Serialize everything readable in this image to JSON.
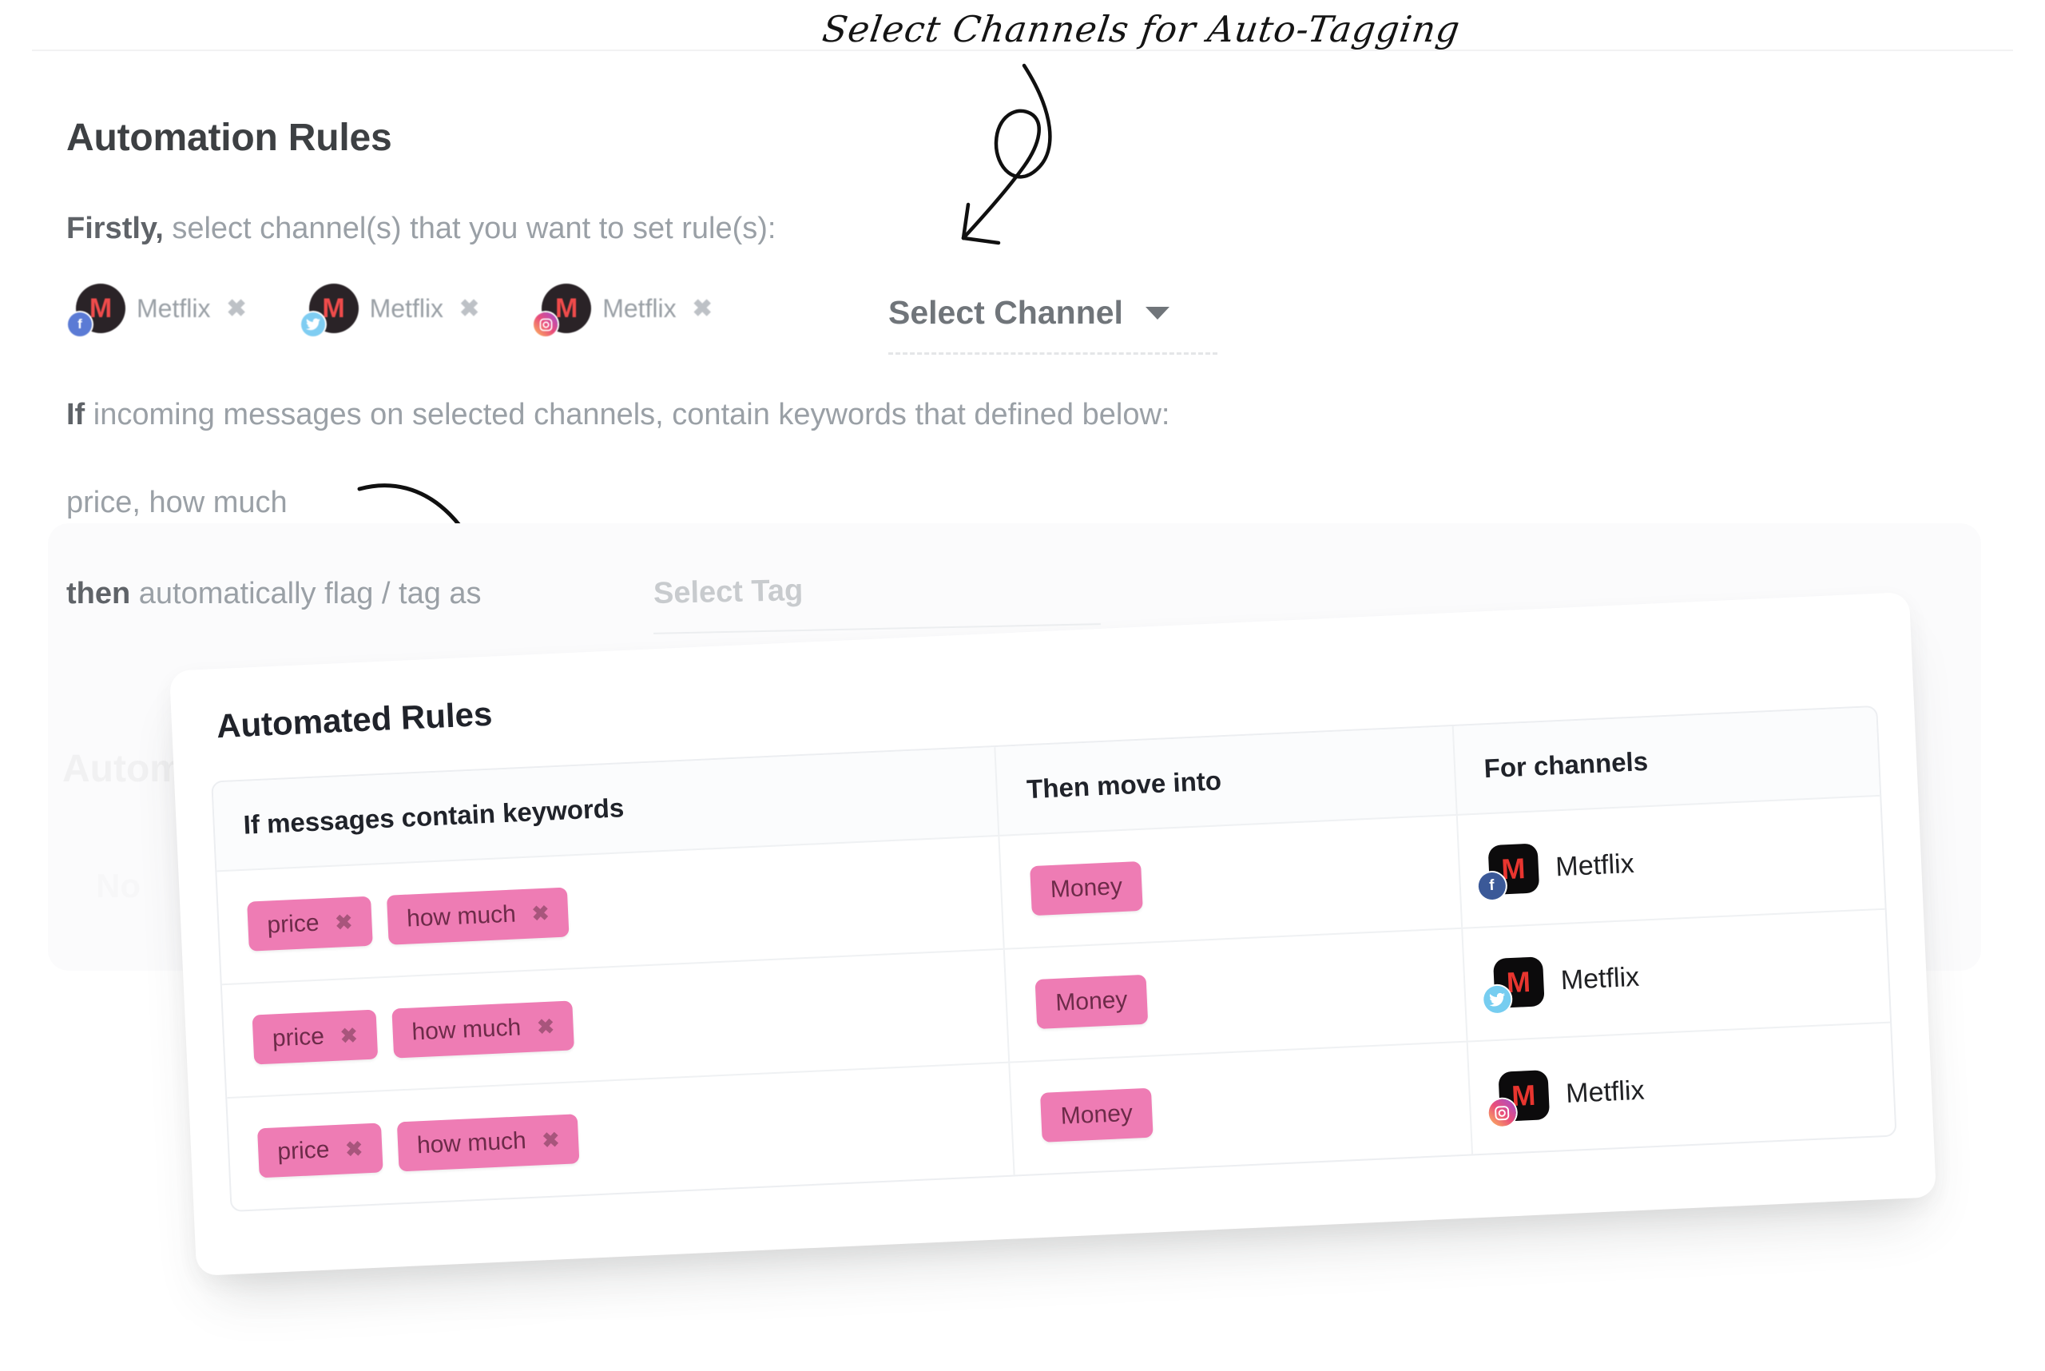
{
  "annotation": {
    "title": "Select Channels for Auto-Tagging"
  },
  "page": {
    "title": "Automation Rules",
    "line_firstly_bold": "Firstly,",
    "line_firstly_rest": " select channel(s) that you want to set rule(s):",
    "line_if_bold": "If",
    "line_if_rest": " incoming messages on selected channels, contain keywords that defined below:",
    "keywords_value": "price, how much",
    "line_then_bold": "then",
    "line_then_rest": " automatically flag / tag as",
    "select_tag_label": "Select Tag",
    "ghost_heading": "Autom",
    "ghost_subtext": "No"
  },
  "channel_chips": [
    {
      "name": "Metflix",
      "initial": "M",
      "network": "facebook",
      "badge_glyph": "f",
      "close_glyph": "✖"
    },
    {
      "name": "Metflix",
      "initial": "M",
      "network": "twitter",
      "badge_glyph": "ᴠ",
      "close_glyph": "✖"
    },
    {
      "name": "Metflix",
      "initial": "M",
      "network": "instagram",
      "badge_glyph": "◎",
      "close_glyph": "✖"
    }
  ],
  "select_channel": {
    "label": "Select Channel",
    "caret_icon": "chevron-down-icon"
  },
  "card": {
    "title": "Automated Rules",
    "columns": [
      "If messages contain keywords",
      "Then move into",
      "For channels"
    ],
    "rows": [
      {
        "keywords": [
          {
            "text": "price",
            "remove_glyph": "✖"
          },
          {
            "text": "how much",
            "remove_glyph": "✖"
          }
        ],
        "move_into": "Money",
        "channel": {
          "name": "Metflix",
          "initial": "M",
          "network": "facebook",
          "badge_glyph": "f"
        }
      },
      {
        "keywords": [
          {
            "text": "price",
            "remove_glyph": "✖"
          },
          {
            "text": "how much",
            "remove_glyph": "✖"
          }
        ],
        "move_into": "Money",
        "channel": {
          "name": "Metflix",
          "initial": "M",
          "network": "twitter",
          "badge_glyph": "ᴠ"
        }
      },
      {
        "keywords": [
          {
            "text": "price",
            "remove_glyph": "✖"
          },
          {
            "text": "how much",
            "remove_glyph": "✖"
          }
        ],
        "move_into": "Money",
        "channel": {
          "name": "Metflix",
          "initial": "M",
          "network": "instagram",
          "badge_glyph": "◎"
        }
      }
    ]
  },
  "colors": {
    "tag_pink": "#ee7cb4",
    "tag_text": "#6d2b49",
    "heading": "#3d4043",
    "muted_text": "#9aa0a6",
    "facebook": "#3b5998",
    "twitter": "#76cdf0",
    "brand_red": "#e8352f"
  }
}
